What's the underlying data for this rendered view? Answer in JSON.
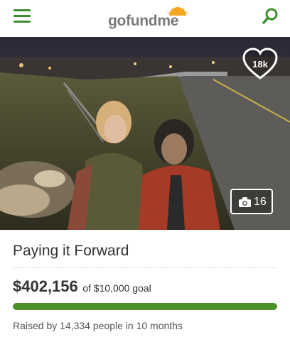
{
  "header": {
    "menu_icon": "hamburger-menu-icon",
    "logo": {
      "part1": "go",
      "part2": "fund",
      "part3": "me"
    },
    "search_icon": "search-icon",
    "brand_color": "#3b8f2e"
  },
  "hero": {
    "likes_count": "18k",
    "heart_icon": "heart-icon",
    "photo_count": "16",
    "camera_icon": "camera-icon"
  },
  "campaign": {
    "title": "Paying it Forward",
    "amount_raised": "$402,156",
    "goal_text": "of $10,000 goal",
    "progress_fraction": 1.0,
    "progress_color": "#4c8f2a",
    "meta_text": "Raised by 14,334 people in 10 months"
  }
}
